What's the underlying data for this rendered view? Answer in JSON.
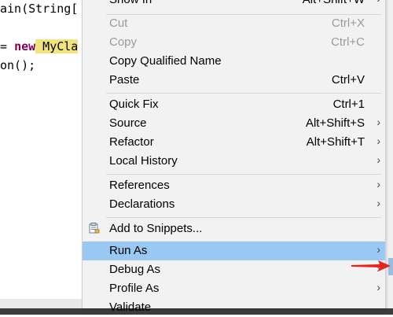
{
  "editor": {
    "lines": [
      {
        "text": "ain(String["
      },
      {
        "op": "= ",
        "kw": "new",
        "cls": " MyCla"
      },
      {
        "text": "on();"
      }
    ]
  },
  "menu": {
    "items": [
      {
        "label": "Show In",
        "accel": "Alt+Shift+W",
        "arrow": "›",
        "disabled": false
      },
      {
        "label": "Cut",
        "accel": "Ctrl+X",
        "disabled": true
      },
      {
        "label": "Copy",
        "accel": "Ctrl+C",
        "disabled": true
      },
      {
        "label": "Copy Qualified Name",
        "accel": "",
        "disabled": false
      },
      {
        "label": "Paste",
        "accel": "Ctrl+V",
        "disabled": false
      },
      {
        "label": "Quick Fix",
        "accel": "Ctrl+1",
        "disabled": false
      },
      {
        "label": "Source",
        "accel": "Alt+Shift+S",
        "arrow": "›",
        "disabled": false
      },
      {
        "label": "Refactor",
        "accel": "Alt+Shift+T",
        "arrow": "›",
        "disabled": false
      },
      {
        "label": "Local History",
        "accel": "",
        "arrow": "›",
        "disabled": false
      },
      {
        "label": "References",
        "accel": "",
        "arrow": "›",
        "disabled": false
      },
      {
        "label": "Declarations",
        "accel": "",
        "arrow": "›",
        "disabled": false
      },
      {
        "label": "Add to Snippets...",
        "accel": "",
        "disabled": false,
        "icon": "snippet-icon"
      },
      {
        "label": "Run As",
        "accel": "",
        "arrow": "›",
        "disabled": false,
        "selected": true
      },
      {
        "label": "Debug As",
        "accel": "",
        "arrow": "›",
        "disabled": false
      },
      {
        "label": "Profile As",
        "accel": "",
        "arrow": "›",
        "disabled": false
      },
      {
        "label": "Validate",
        "accel": "",
        "disabled": false
      }
    ]
  },
  "colors": {
    "menu_bg": "#f2f2f2",
    "selection": "#99c9f2",
    "disabled_text": "#9a9a9a",
    "keyword": "#7f0055",
    "highlight": "#f2e47a",
    "annotation_arrow": "#e8231c"
  }
}
